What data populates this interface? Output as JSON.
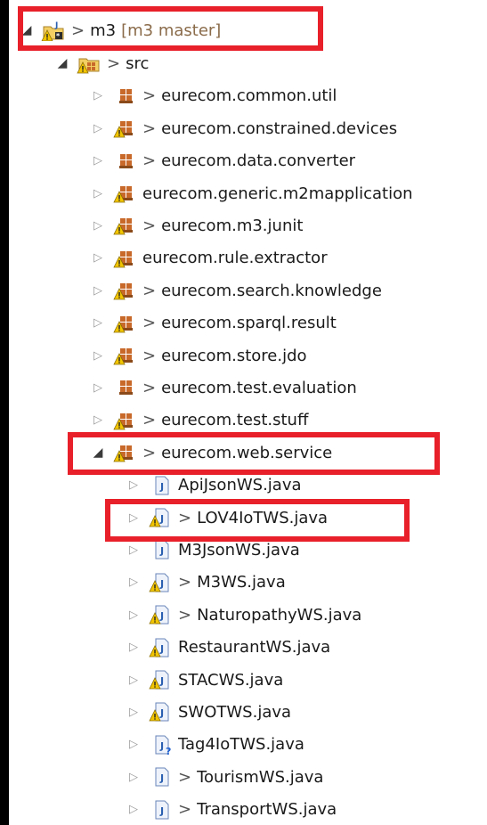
{
  "tree": {
    "root": {
      "label": "m3",
      "dirty_marker": ">",
      "branch": "[m3 master]"
    },
    "src": {
      "label": "src",
      "dirty_marker": ">"
    },
    "packages": [
      {
        "label": "eurecom.common.util",
        "dirty_marker": ">",
        "warn": false
      },
      {
        "label": "eurecom.constrained.devices",
        "dirty_marker": ">",
        "warn": true
      },
      {
        "label": "eurecom.data.converter",
        "dirty_marker": ">",
        "warn": false
      },
      {
        "label": "eurecom.generic.m2mapplication",
        "dirty_marker": "",
        "warn": true
      },
      {
        "label": "eurecom.m3.junit",
        "dirty_marker": ">",
        "warn": true
      },
      {
        "label": "eurecom.rule.extractor",
        "dirty_marker": "",
        "warn": true
      },
      {
        "label": "eurecom.search.knowledge",
        "dirty_marker": ">",
        "warn": true
      },
      {
        "label": "eurecom.sparql.result",
        "dirty_marker": ">",
        "warn": true
      },
      {
        "label": "eurecom.store.jdo",
        "dirty_marker": ">",
        "warn": true
      },
      {
        "label": "eurecom.test.evaluation",
        "dirty_marker": ">",
        "warn": false
      },
      {
        "label": "eurecom.test.stuff",
        "dirty_marker": ">",
        "warn": true
      },
      {
        "label": "eurecom.web.service",
        "dirty_marker": ">",
        "warn": true
      }
    ],
    "files": [
      {
        "label": "ApiJsonWS.java",
        "dirty_marker": "",
        "overlay": "none"
      },
      {
        "label": "LOV4IoTWS.java",
        "dirty_marker": ">",
        "overlay": "warning"
      },
      {
        "label": "M3JsonWS.java",
        "dirty_marker": "",
        "overlay": "none"
      },
      {
        "label": "M3WS.java",
        "dirty_marker": ">",
        "overlay": "warning"
      },
      {
        "label": "NaturopathyWS.java",
        "dirty_marker": ">",
        "overlay": "warning"
      },
      {
        "label": "RestaurantWS.java",
        "dirty_marker": "",
        "overlay": "warning"
      },
      {
        "label": "STACWS.java",
        "dirty_marker": "",
        "overlay": "warning"
      },
      {
        "label": "SWOTWS.java",
        "dirty_marker": "",
        "overlay": "warning"
      },
      {
        "label": "Tag4IoTWS.java",
        "dirty_marker": "",
        "overlay": "question"
      },
      {
        "label": "TourismWS.java",
        "dirty_marker": ">",
        "overlay": "none"
      },
      {
        "label": "TransportWS.java",
        "dirty_marker": ">",
        "overlay": "none"
      }
    ],
    "icons": {
      "expanded": "triangle-down-icon",
      "collapsed": "triangle-right-icon",
      "project": "java-project-icon",
      "source_folder": "source-folder-icon",
      "package": "package-icon",
      "java_file": "java-file-icon"
    },
    "colors": {
      "highlight": "#e8202a",
      "warning": "#f2c500",
      "package": "#c8692a",
      "java": "#2a5fb0"
    }
  }
}
